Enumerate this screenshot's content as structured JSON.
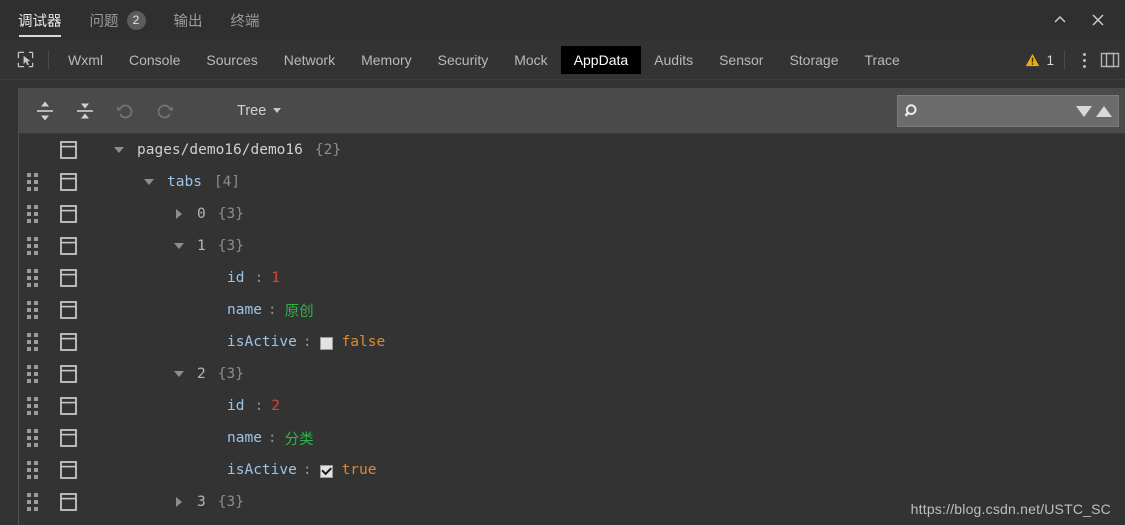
{
  "titlebar": {
    "tabs": [
      {
        "label": "调试器",
        "active": true,
        "badge": null
      },
      {
        "label": "问题",
        "active": false,
        "badge": "2"
      },
      {
        "label": "输出",
        "active": false,
        "badge": null
      },
      {
        "label": "终端",
        "active": false,
        "badge": null
      }
    ],
    "collapse_icon": "chevron-up-icon",
    "close_icon": "close-icon"
  },
  "devtools": {
    "inspect_icon": "cursor-select-icon",
    "tabs": [
      {
        "label": "Wxml",
        "active": false
      },
      {
        "label": "Console",
        "active": false
      },
      {
        "label": "Sources",
        "active": false
      },
      {
        "label": "Network",
        "active": false
      },
      {
        "label": "Memory",
        "active": false
      },
      {
        "label": "Security",
        "active": false
      },
      {
        "label": "Mock",
        "active": false
      },
      {
        "label": "AppData",
        "active": true
      },
      {
        "label": "Audits",
        "active": false
      },
      {
        "label": "Sensor",
        "active": false
      },
      {
        "label": "Storage",
        "active": false
      },
      {
        "label": "Trace",
        "active": false
      }
    ],
    "warning_icon": "warning-triangle-icon",
    "warning_count": "1",
    "warning_color": "#e8b018",
    "more_icon": "kebab-menu-icon",
    "dock_icon": "dock-panel-icon"
  },
  "toolbar": {
    "expand_all_icon": "expand-all-icon",
    "collapse_all_icon": "collapse-all-icon",
    "undo_icon": "undo-icon",
    "redo_icon": "redo-icon",
    "view_mode": "Tree",
    "view_mode_caret": "chevron-down-icon",
    "search": {
      "icon": "search-icon",
      "value": "",
      "placeholder": "",
      "next_icon": "triangle-down-icon",
      "prev_icon": "triangle-up-icon"
    }
  },
  "tree": {
    "rows": [
      {
        "handle": false,
        "indent": 0,
        "twisty": "open",
        "key": "pages/demo16/demo16",
        "key_kind": "path",
        "count": "{2}"
      },
      {
        "handle": true,
        "indent": 1,
        "twisty": "open",
        "key": "tabs",
        "key_kind": "prop",
        "count": "[4]"
      },
      {
        "handle": true,
        "indent": 2,
        "twisty": "closed",
        "key": "0",
        "key_kind": "index",
        "count": "{3}"
      },
      {
        "handle": true,
        "indent": 2,
        "twisty": "open",
        "key": "1",
        "key_kind": "index",
        "count": "{3}"
      },
      {
        "handle": true,
        "indent": 3,
        "twisty": "none",
        "key": "id",
        "key_kind": "prop",
        "colon": ":",
        "value": "1",
        "value_kind": "number"
      },
      {
        "handle": true,
        "indent": 3,
        "twisty": "none",
        "key": "name",
        "key_kind": "prop",
        "colon": ":",
        "value": "原创",
        "value_kind": "string"
      },
      {
        "handle": true,
        "indent": 3,
        "twisty": "none",
        "key": "isActive",
        "key_kind": "prop",
        "colon": ":",
        "value": "false",
        "value_kind": "boolean",
        "checkbox": false
      },
      {
        "handle": true,
        "indent": 2,
        "twisty": "open",
        "key": "2",
        "key_kind": "index",
        "count": "{3}"
      },
      {
        "handle": true,
        "indent": 3,
        "twisty": "none",
        "key": "id",
        "key_kind": "prop",
        "colon": ":",
        "value": "2",
        "value_kind": "number"
      },
      {
        "handle": true,
        "indent": 3,
        "twisty": "none",
        "key": "name",
        "key_kind": "prop",
        "colon": ":",
        "value": "分类",
        "value_kind": "string"
      },
      {
        "handle": true,
        "indent": 3,
        "twisty": "none",
        "key": "isActive",
        "key_kind": "prop",
        "colon": ":",
        "value": "true",
        "value_kind": "boolean",
        "checkbox": true
      },
      {
        "handle": true,
        "indent": 2,
        "twisty": "closed",
        "key": "3",
        "key_kind": "index",
        "count": "{3}"
      }
    ],
    "colors": {
      "number": "#e0452f",
      "string": "#2fb344",
      "boolean": "#e08a2e",
      "property": "#9bc4e8",
      "count": "#8d8d8d"
    }
  },
  "watermark": {
    "text": "https://blog.csdn.net/USTC_SC"
  }
}
